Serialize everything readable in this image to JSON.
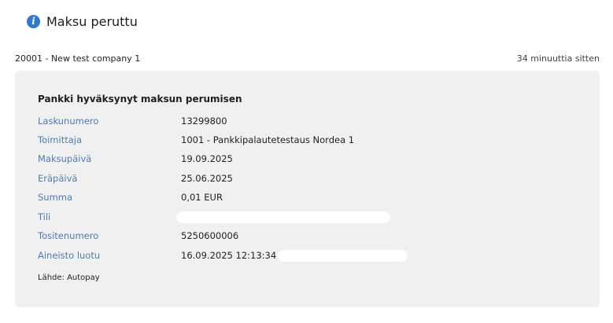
{
  "header": {
    "icon": "info-icon",
    "title": "Maksu peruttu"
  },
  "meta": {
    "company": "20001 - New test company 1",
    "time": "34 minuuttia sitten"
  },
  "card": {
    "title": "Pankki hyväksynyt maksun perumisen",
    "rows": [
      {
        "label": "Laskunumero",
        "value": "13299800"
      },
      {
        "label": "Toimittaja",
        "value": "1001 - Pankkipalautetestaus Nordea 1"
      },
      {
        "label": "Maksupäivä",
        "value": "19.09.2025"
      },
      {
        "label": "Eräpäivä",
        "value": "25.06.2025"
      },
      {
        "label": "Summa",
        "value": "0,01 EUR"
      },
      {
        "label": "Tili",
        "value": ""
      },
      {
        "label": "Tositenumero",
        "value": "5250600006"
      },
      {
        "label": "Aineisto luotu",
        "value": "16.09.2025 12:13:34"
      }
    ],
    "source": "Lähde: Autopay"
  },
  "colors": {
    "accent": "#2f7ad1",
    "label": "#4a7db0",
    "card_bg": "#f0f0f0"
  }
}
